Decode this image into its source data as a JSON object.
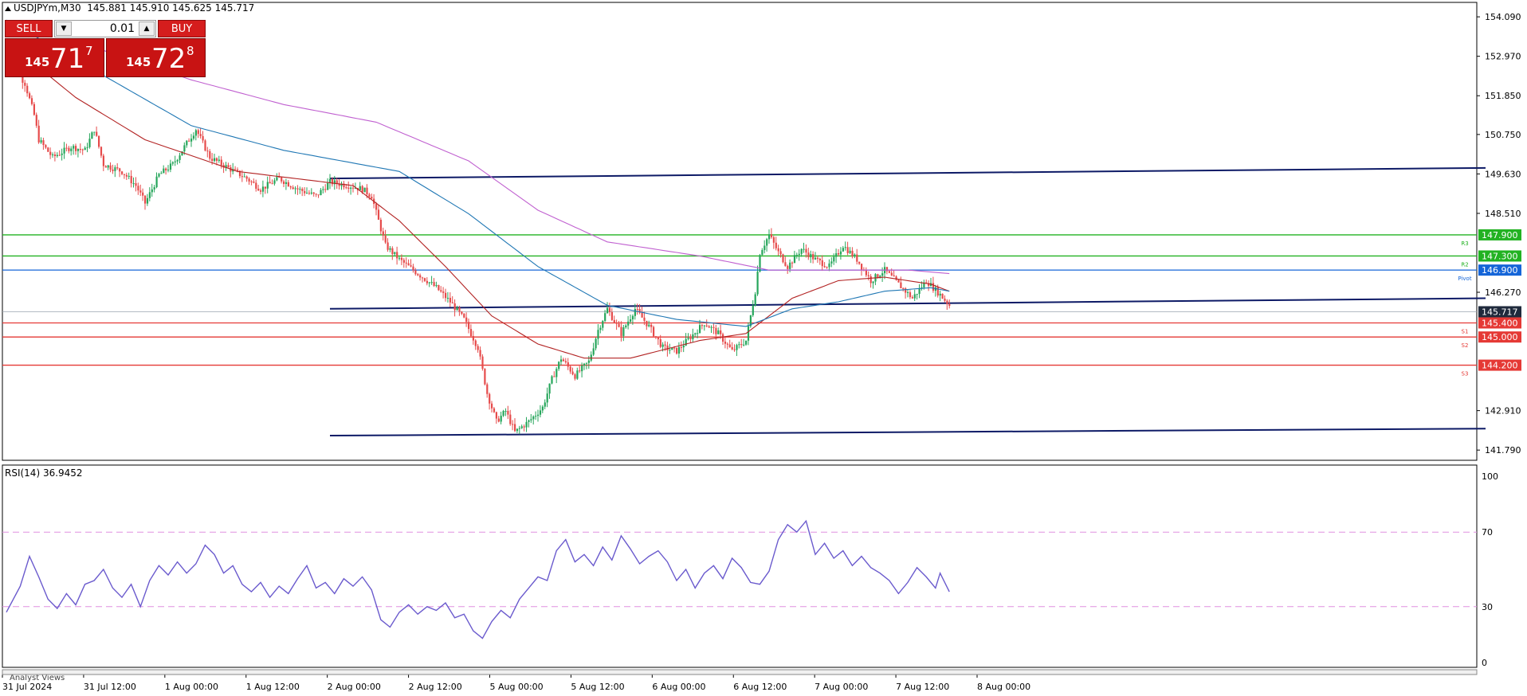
{
  "header": {
    "symbol": "USDJPYm,M30",
    "open": "145.881",
    "high": "145.910",
    "low": "145.625",
    "close": "145.717"
  },
  "trade_panel": {
    "sell_label": "SELL",
    "buy_label": "BUY",
    "lot": "0.01",
    "bid_small": "145",
    "bid_big": "71",
    "bid_sup": "7",
    "ask_small": "145",
    "ask_big": "72",
    "ask_sup": "8",
    "button_color": "#d51d1d"
  },
  "rsi_title": "RSI(14) 36.9452",
  "footer_tab": "Analyst Views",
  "colors": {
    "bull": "#26a65b",
    "bear": "#e64b4b",
    "ma_fast": "#b22222",
    "ma_mid": "#1f77b4",
    "ma_slow": "#c060d0",
    "channel": "#0d1a66",
    "resistance": "#22b222",
    "pivot": "#1565d8",
    "support": "#e53935",
    "rsi": "#6a5acd",
    "rsi_levels": "#e090e0",
    "current_price_tag": "#1f2a3c"
  },
  "chart_data": [
    {
      "type": "candlestick",
      "title": "USDJPYm,M30",
      "ylim": [
        141.5,
        154.5
      ],
      "yticks": [
        "154.090",
        "152.970",
        "151.850",
        "150.750",
        "149.630",
        "148.510",
        "146.270",
        "142.910",
        "141.790"
      ],
      "xticks": [
        "31 Jul 2024",
        "31 Jul 12:00",
        "1 Aug 00:00",
        "1 Aug 12:00",
        "2 Aug 00:00",
        "2 Aug 12:00",
        "5 Aug 00:00",
        "5 Aug 12:00",
        "6 Aug 00:00",
        "6 Aug 12:00",
        "7 Aug 00:00",
        "7 Aug 12:00",
        "8 Aug 00:00"
      ],
      "price_path": [
        [
          0,
          152.9
        ],
        [
          4,
          152.6
        ],
        [
          8,
          152.2
        ],
        [
          12,
          151.3
        ],
        [
          14,
          150.6
        ],
        [
          20,
          150.1
        ],
        [
          28,
          150.4
        ],
        [
          34,
          150.3
        ],
        [
          38,
          150.9
        ],
        [
          42,
          149.9
        ],
        [
          50,
          149.7
        ],
        [
          56,
          149.3
        ],
        [
          60,
          148.8
        ],
        [
          66,
          149.6
        ],
        [
          72,
          149.9
        ],
        [
          78,
          150.5
        ],
        [
          82,
          150.9
        ],
        [
          88,
          150.1
        ],
        [
          96,
          149.8
        ],
        [
          104,
          149.5
        ],
        [
          110,
          149.2
        ],
        [
          118,
          149.5
        ],
        [
          126,
          149.2
        ],
        [
          134,
          149.0
        ],
        [
          140,
          149.4
        ],
        [
          148,
          149.3
        ],
        [
          154,
          149.2
        ],
        [
          158,
          149.0
        ],
        [
          164,
          147.6
        ],
        [
          170,
          147.2
        ],
        [
          178,
          146.8
        ],
        [
          186,
          146.4
        ],
        [
          192,
          146.0
        ],
        [
          198,
          145.5
        ],
        [
          204,
          144.7
        ],
        [
          208,
          143.4
        ],
        [
          212,
          142.6
        ],
        [
          216,
          142.9
        ],
        [
          220,
          142.3
        ],
        [
          226,
          142.6
        ],
        [
          232,
          143.0
        ],
        [
          236,
          143.8
        ],
        [
          240,
          144.4
        ],
        [
          246,
          143.9
        ],
        [
          252,
          144.3
        ],
        [
          256,
          145.2
        ],
        [
          260,
          145.8
        ],
        [
          266,
          145.1
        ],
        [
          272,
          145.8
        ],
        [
          278,
          145.3
        ],
        [
          284,
          144.7
        ],
        [
          290,
          144.6
        ],
        [
          296,
          145.0
        ],
        [
          302,
          145.4
        ],
        [
          308,
          145.1
        ],
        [
          314,
          144.6
        ],
        [
          320,
          144.9
        ],
        [
          324,
          146.3
        ],
        [
          326,
          147.4
        ],
        [
          330,
          147.9
        ],
        [
          334,
          147.4
        ],
        [
          338,
          147.0
        ],
        [
          344,
          147.5
        ],
        [
          350,
          147.2
        ],
        [
          356,
          147.0
        ],
        [
          362,
          147.6
        ],
        [
          368,
          147.2
        ],
        [
          374,
          146.6
        ],
        [
          380,
          146.9
        ],
        [
          386,
          146.5
        ],
        [
          392,
          146.1
        ],
        [
          398,
          146.6
        ],
        [
          404,
          146.2
        ],
        [
          408,
          145.9
        ]
      ],
      "moving_averages": [
        {
          "color_key": "ma_fast",
          "path": [
            [
              0,
              153.4
            ],
            [
              30,
              151.8
            ],
            [
              60,
              150.6
            ],
            [
              100,
              149.7
            ],
            [
              150,
              149.3
            ],
            [
              170,
              148.3
            ],
            [
              190,
              147.0
            ],
            [
              210,
              145.6
            ],
            [
              230,
              144.8
            ],
            [
              250,
              144.4
            ],
            [
              270,
              144.4
            ],
            [
              300,
              144.9
            ],
            [
              320,
              145.1
            ],
            [
              340,
              146.1
            ],
            [
              360,
              146.6
            ],
            [
              380,
              146.7
            ],
            [
              400,
              146.5
            ],
            [
              408,
              146.3
            ]
          ]
        },
        {
          "color_key": "ma_mid",
          "path": [
            [
              0,
              154.0
            ],
            [
              40,
              152.5
            ],
            [
              80,
              151.0
            ],
            [
              120,
              150.3
            ],
            [
              170,
              149.7
            ],
            [
              200,
              148.5
            ],
            [
              230,
              147.0
            ],
            [
              260,
              145.9
            ],
            [
              290,
              145.5
            ],
            [
              320,
              145.3
            ],
            [
              340,
              145.8
            ],
            [
              360,
              146.0
            ],
            [
              380,
              146.3
            ],
            [
              400,
              146.4
            ],
            [
              408,
              146.3
            ]
          ]
        },
        {
          "color_key": "ma_slow",
          "path": [
            [
              30,
              153.4
            ],
            [
              80,
              152.3
            ],
            [
              120,
              151.6
            ],
            [
              160,
              151.1
            ],
            [
              200,
              150.0
            ],
            [
              230,
              148.6
            ],
            [
              260,
              147.7
            ],
            [
              300,
              147.3
            ],
            [
              330,
              146.9
            ],
            [
              360,
              146.9
            ],
            [
              390,
              146.9
            ],
            [
              408,
              146.8
            ]
          ]
        }
      ],
      "channel_lines": [
        {
          "x": [
            140,
            640
          ],
          "y": [
            149.5,
            149.8
          ]
        },
        {
          "x": [
            140,
            640
          ],
          "y": [
            145.8,
            146.1
          ]
        },
        {
          "x": [
            140,
            640
          ],
          "y": [
            142.2,
            142.4
          ]
        }
      ],
      "levels": [
        {
          "value": 147.9,
          "label": "147.900",
          "marker": "R3",
          "color_key": "resistance"
        },
        {
          "value": 147.3,
          "label": "147.300",
          "marker": "R2",
          "color_key": "resistance"
        },
        {
          "value": 146.9,
          "label": "146.900",
          "marker": "Pivot",
          "color_key": "pivot"
        },
        {
          "value": 145.4,
          "label": "145.400",
          "marker": "S1",
          "color_key": "support"
        },
        {
          "value": 145.0,
          "label": "145.000",
          "marker": "S2",
          "color_key": "support"
        },
        {
          "value": 144.2,
          "label": "144.200",
          "marker": "S3",
          "color_key": "support"
        }
      ],
      "current_price": {
        "value": 145.717,
        "label": "145.717"
      }
    },
    {
      "type": "line",
      "title": "RSI(14) 36.9452",
      "ylim": [
        0,
        100
      ],
      "yticks": [
        "100",
        "70",
        "30",
        "0"
      ],
      "levels": [
        70,
        30
      ],
      "values": [
        [
          0,
          27
        ],
        [
          6,
          41
        ],
        [
          10,
          57
        ],
        [
          14,
          46
        ],
        [
          18,
          34
        ],
        [
          22,
          29
        ],
        [
          26,
          37
        ],
        [
          30,
          31
        ],
        [
          34,
          42
        ],
        [
          38,
          44
        ],
        [
          42,
          50
        ],
        [
          46,
          40
        ],
        [
          50,
          35
        ],
        [
          54,
          42
        ],
        [
          58,
          30
        ],
        [
          62,
          44
        ],
        [
          66,
          52
        ],
        [
          70,
          47
        ],
        [
          74,
          54
        ],
        [
          78,
          48
        ],
        [
          82,
          53
        ],
        [
          86,
          63
        ],
        [
          90,
          58
        ],
        [
          94,
          48
        ],
        [
          98,
          52
        ],
        [
          102,
          42
        ],
        [
          106,
          38
        ],
        [
          110,
          43
        ],
        [
          114,
          35
        ],
        [
          118,
          41
        ],
        [
          122,
          37
        ],
        [
          126,
          45
        ],
        [
          130,
          52
        ],
        [
          134,
          40
        ],
        [
          138,
          43
        ],
        [
          142,
          37
        ],
        [
          146,
          45
        ],
        [
          150,
          41
        ],
        [
          154,
          46
        ],
        [
          158,
          39
        ],
        [
          162,
          23
        ],
        [
          166,
          19
        ],
        [
          170,
          27
        ],
        [
          174,
          31
        ],
        [
          178,
          26
        ],
        [
          182,
          30
        ],
        [
          186,
          28
        ],
        [
          190,
          32
        ],
        [
          194,
          24
        ],
        [
          198,
          26
        ],
        [
          202,
          17
        ],
        [
          206,
          13
        ],
        [
          210,
          22
        ],
        [
          214,
          28
        ],
        [
          218,
          24
        ],
        [
          222,
          34
        ],
        [
          226,
          40
        ],
        [
          230,
          46
        ],
        [
          234,
          44
        ],
        [
          238,
          60
        ],
        [
          242,
          66
        ],
        [
          246,
          54
        ],
        [
          250,
          58
        ],
        [
          254,
          52
        ],
        [
          258,
          62
        ],
        [
          262,
          55
        ],
        [
          266,
          68
        ],
        [
          270,
          61
        ],
        [
          274,
          53
        ],
        [
          278,
          57
        ],
        [
          282,
          60
        ],
        [
          286,
          54
        ],
        [
          290,
          44
        ],
        [
          294,
          50
        ],
        [
          298,
          40
        ],
        [
          302,
          48
        ],
        [
          306,
          52
        ],
        [
          310,
          45
        ],
        [
          314,
          56
        ],
        [
          318,
          51
        ],
        [
          322,
          43
        ],
        [
          326,
          42
        ],
        [
          330,
          49
        ],
        [
          334,
          66
        ],
        [
          338,
          74
        ],
        [
          342,
          70
        ],
        [
          346,
          76
        ],
        [
          350,
          58
        ],
        [
          354,
          64
        ],
        [
          358,
          56
        ],
        [
          362,
          60
        ],
        [
          366,
          52
        ],
        [
          370,
          57
        ],
        [
          374,
          51
        ],
        [
          378,
          48
        ],
        [
          382,
          44
        ],
        [
          386,
          37
        ],
        [
          390,
          43
        ],
        [
          394,
          51
        ],
        [
          398,
          46
        ],
        [
          402,
          40
        ],
        [
          404,
          48
        ],
        [
          408,
          38
        ]
      ]
    }
  ]
}
